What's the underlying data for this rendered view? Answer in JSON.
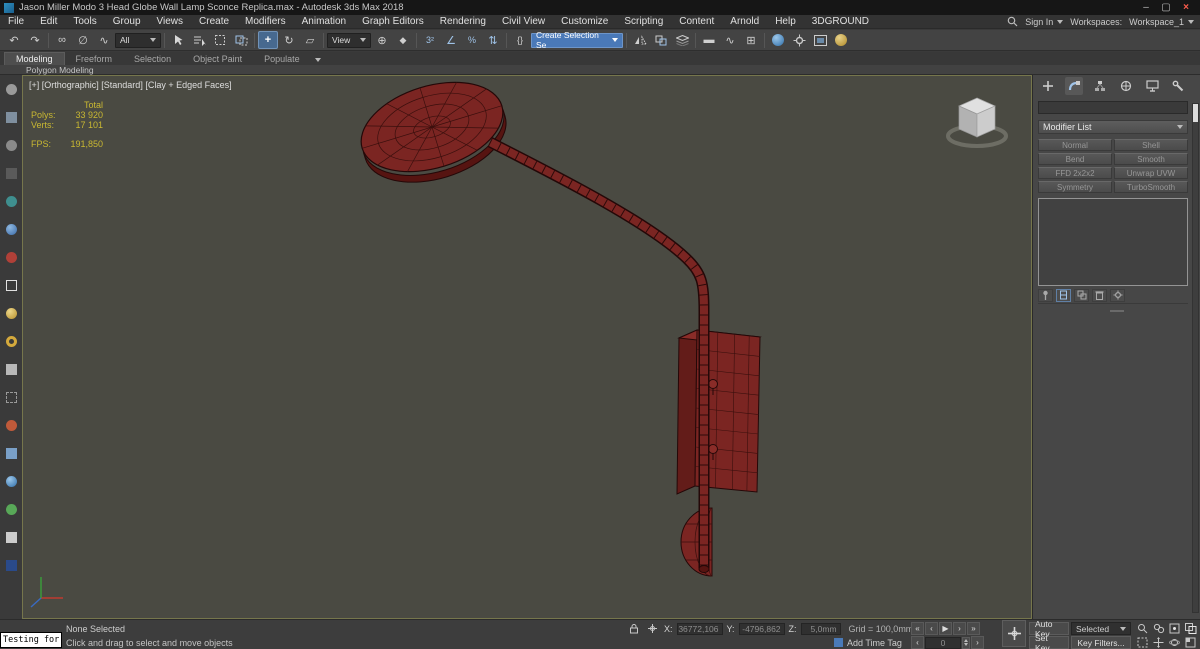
{
  "window": {
    "title": "Jason Miller Modo 3 Head Globe Wall Lamp Sconce Replica.max - Autodesk 3ds Max 2018"
  },
  "menu": {
    "items": [
      "File",
      "Edit",
      "Tools",
      "Group",
      "Views",
      "Create",
      "Modifiers",
      "Animation",
      "Graph Editors",
      "Rendering",
      "Civil View",
      "Customize",
      "Scripting",
      "Content",
      "Arnold",
      "Help",
      "3DGROUND"
    ]
  },
  "account": {
    "sign_in": "Sign In",
    "workspaces_label": "Workspaces:",
    "workspace": "Workspace_1"
  },
  "toolbar": {
    "selection_filter": "All",
    "ref_coord": "View",
    "create_selection_set": "Create Selection Se"
  },
  "icons": {
    "undo": "↶",
    "redo": "↷",
    "link": "∞",
    "unlink": "∅",
    "bind": "∿",
    "move": "+",
    "rotate": "↻",
    "scale": "▱",
    "pivot": "⊕",
    "manipulate": "◆",
    "snap": "3²",
    "angle_snap": "∠",
    "percent_snap": "%",
    "spinner_snap": "⇅",
    "named_sets": "{}",
    "ribbon_min": "▬",
    "schematic": "⊞",
    "curve": "∿",
    "minimize": "–",
    "maximize": "▢",
    "close": "×",
    "tr_start": "«",
    "tr_prev": "‹",
    "tr_play": "▶",
    "tr_next": "›",
    "tr_end": "»"
  },
  "ribbon": {
    "tabs": [
      "Modeling",
      "Freeform",
      "Selection",
      "Object Paint",
      "Populate"
    ],
    "subtab": "Polygon Modeling"
  },
  "viewport": {
    "header": "[+] [Orthographic] [Standard] [Clay + Edged Faces]",
    "stats": {
      "total_label": "Total",
      "polys_label": "Polys:",
      "polys_value": "33 920",
      "verts_label": "Verts:",
      "verts_value": "17 101",
      "fps_label": "FPS:",
      "fps_value": "191,850"
    }
  },
  "command_panel": {
    "modifier_list_label": "Modifier List",
    "modifier_buttons": [
      "Normal",
      "Shell",
      "Bend",
      "Smooth",
      "FFD 2x2x2",
      "Unwrap UVW",
      "Symmetry",
      "TurboSmooth"
    ]
  },
  "status": {
    "selection": "None Selected",
    "hint": "Click and drag to select and move objects",
    "x_label": "X:",
    "x_value": "36772,106",
    "y_label": "Y:",
    "y_value": "-4796,862",
    "z_label": "Z:",
    "z_value": "5,0mm",
    "grid": "Grid = 100,0mm",
    "auto_key": "Auto Key",
    "selected": "Selected",
    "set_key": "Set Key",
    "key_filters": "Key Filters...",
    "add_time_tag": "Add Time Tag",
    "frame": "0"
  },
  "overlay": {
    "text": "Testing for"
  },
  "colors": {
    "accent_blue": "#4a79b8",
    "model_red": "#7b2522",
    "stats_yellow": "#c9b832",
    "viewport_bg": "#4a4a42"
  }
}
